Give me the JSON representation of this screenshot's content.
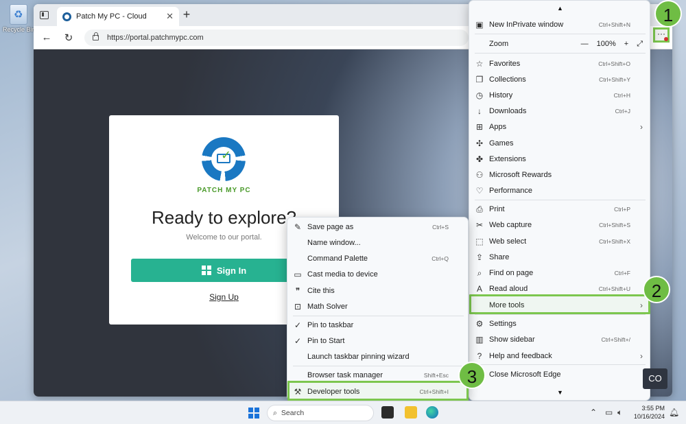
{
  "desktop": {
    "recycle_bin_label": "Recycle Bin"
  },
  "browser": {
    "tab_title": "Patch My PC - Cloud",
    "address_url": "https://portal.patchmypc.com"
  },
  "page": {
    "brand": "PATCH MY PC",
    "title": "Ready to explore?",
    "subtitle": "Welcome to our portal.",
    "signin_label": "Sign In",
    "signup_label": "Sign Up"
  },
  "main_menu": {
    "new_inprivate": {
      "label": "New InPrivate window",
      "shortcut": "Ctrl+Shift+N"
    },
    "zoom": {
      "label": "Zoom",
      "value": "100%",
      "minus": "—",
      "plus": "+"
    },
    "favorites": {
      "label": "Favorites",
      "shortcut": "Ctrl+Shift+O"
    },
    "collections": {
      "label": "Collections",
      "shortcut": "Ctrl+Shift+Y"
    },
    "history": {
      "label": "History",
      "shortcut": "Ctrl+H"
    },
    "downloads": {
      "label": "Downloads",
      "shortcut": "Ctrl+J"
    },
    "apps": {
      "label": "Apps"
    },
    "games": {
      "label": "Games"
    },
    "extensions": {
      "label": "Extensions"
    },
    "rewards": {
      "label": "Microsoft Rewards"
    },
    "performance": {
      "label": "Performance"
    },
    "print": {
      "label": "Print",
      "shortcut": "Ctrl+P"
    },
    "web_capture": {
      "label": "Web capture",
      "shortcut": "Ctrl+Shift+S"
    },
    "web_select": {
      "label": "Web select",
      "shortcut": "Ctrl+Shift+X"
    },
    "share": {
      "label": "Share"
    },
    "find": {
      "label": "Find on page",
      "shortcut": "Ctrl+F"
    },
    "read_aloud": {
      "label": "Read aloud",
      "shortcut": "Ctrl+Shift+U"
    },
    "more_tools": {
      "label": "More tools"
    },
    "settings": {
      "label": "Settings"
    },
    "show_sidebar": {
      "label": "Show sidebar",
      "shortcut": "Ctrl+Shift+/"
    },
    "help": {
      "label": "Help and feedback"
    },
    "close": {
      "label": "Close Microsoft Edge"
    }
  },
  "sub_menu": {
    "save_page": {
      "label": "Save page as",
      "shortcut": "Ctrl+S"
    },
    "name_window": {
      "label": "Name window..."
    },
    "command_palette": {
      "label": "Command Palette",
      "shortcut": "Ctrl+Q"
    },
    "cast": {
      "label": "Cast media to device"
    },
    "cite": {
      "label": "Cite this"
    },
    "math": {
      "label": "Math Solver"
    },
    "pin_taskbar": {
      "label": "Pin to taskbar"
    },
    "pin_start": {
      "label": "Pin to Start"
    },
    "pin_wizard": {
      "label": "Launch taskbar pinning wizard"
    },
    "task_manager": {
      "label": "Browser task manager",
      "shortcut": "Shift+Esc"
    },
    "dev_tools": {
      "label": "Developer tools",
      "shortcut": "Ctrl+Shift+I"
    }
  },
  "markers": {
    "m1": "1",
    "m2": "2",
    "m3": "3"
  },
  "corner_badge": "CO",
  "taskbar": {
    "search_placeholder": "Search",
    "time": "3:55 PM",
    "date": "10/16/2024"
  },
  "colors": {
    "accent_green": "#7cc64e",
    "signin_teal": "#27b291",
    "brand_blue": "#1a78c2"
  }
}
